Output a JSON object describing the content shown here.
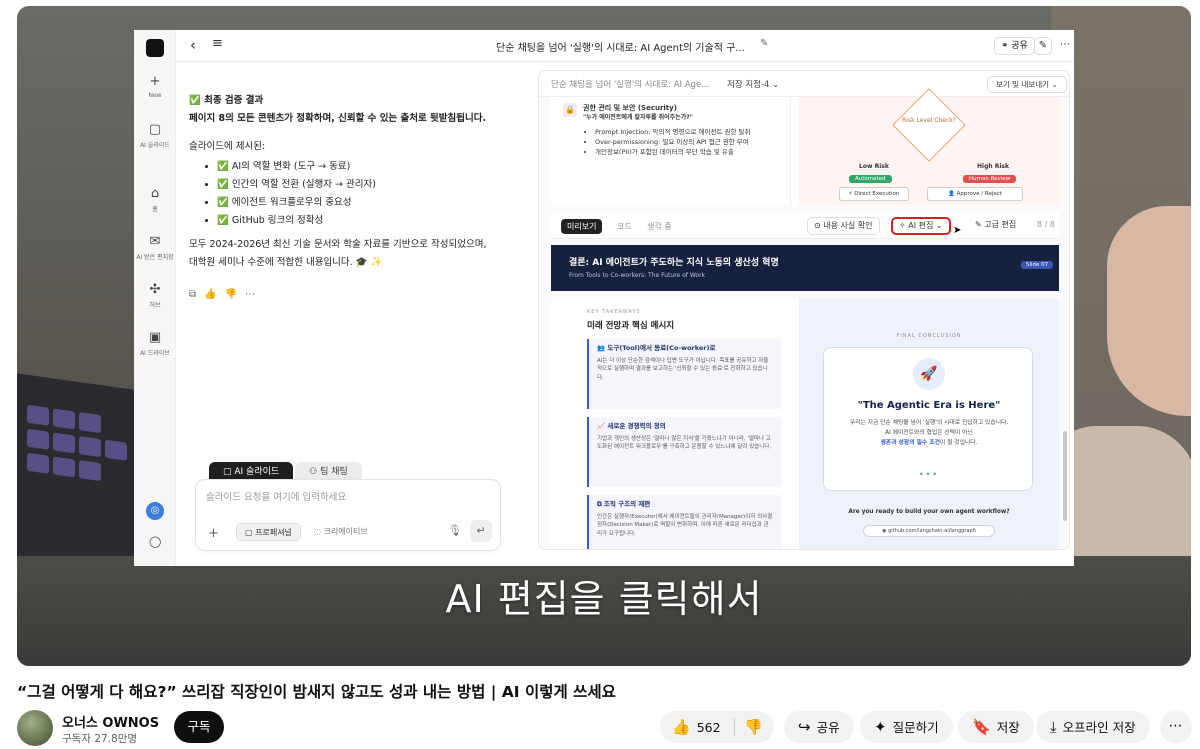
{
  "app": {
    "title": "단순 채팅을 넘어 '실행'의 시대로: AI Agent의 기술적 구...",
    "share": "공유"
  },
  "rail": {
    "items": [
      {
        "label": "New",
        "icon": "plus-icon"
      },
      {
        "label": "AI 슬라이드",
        "icon": "slides-icon"
      },
      {
        "label": "홈",
        "icon": "home-icon"
      },
      {
        "label": "AI 받은 편지함",
        "icon": "inbox-icon"
      },
      {
        "label": "허브",
        "icon": "hub-icon"
      },
      {
        "label": "AI 드라이브",
        "icon": "drive-icon"
      }
    ]
  },
  "chat": {
    "heading": "✅ 최종 검증 결과",
    "summary": "페이지 8의 모든 콘텐츠가 정확하며, 신뢰할 수 있는 출처로 뒷받침됩니다.",
    "intro": "슬라이드에 제시된:",
    "bullets": [
      "✅ AI의 역할 변화 (도구 → 동료)",
      "✅ 인간의 역할 전환 (실행자 → 관리자)",
      "✅ 에이전트 워크플로우의 중요성",
      "✅ GitHub 링크의 정확성"
    ],
    "closing_1": "모두 2024-2026년 최신 기술 문서와 학술 자료를 기반으로 작성되었으며,",
    "closing_2": "대학원 세미나 수준에 적합한 내용입니다. 🎓 ✨"
  },
  "composer": {
    "tab_active": "AI 슬라이드",
    "tab_inactive": "팀 채팅",
    "placeholder": "슬라이드 요청을 여기에 입력하세요",
    "mode_selected": "프로페셔널",
    "mode_other": "크리에이티브"
  },
  "slides": {
    "doc_title": "단순 채팅을 넘어 '실행'의 시대로: AI Age...",
    "version": "저장 지점-4",
    "export": "보기 및 내보내기",
    "top_slide": {
      "section": "권한 관리 및 보안 (Security)",
      "question": "\"누가 에이전트에게 칼자루를 쥐어주는가?\"",
      "items": [
        "Prompt Injection: 악의적 명령으로 에이전트 권한 탈취",
        "Over-permissioning: 필요 이상의 API 접근 권한 부여",
        "개인정보(PII)가 포함된 데이터의 무단 학습 및 유출"
      ],
      "diamond": "Risk Level Check?",
      "low": "Low Risk",
      "high": "High Risk",
      "low_pill": "Automated",
      "high_pill": "Human Review",
      "action_a": "Direct Execution",
      "action_b": "Approve / Reject"
    },
    "toolbar": {
      "preview": "미리보기",
      "code": "코드",
      "thinking": "생각 중",
      "fact_check": "내용 사실 확인",
      "ai_edit": "AI 편집",
      "advanced_edit": "고급 편집",
      "pages": "8 / 8"
    },
    "slide8": {
      "title": "결론: AI 에이전트가 주도하는 지식 노동의 생산성 혁명",
      "subtitle": "From Tools to Co-workers: The Future of Work",
      "badge": "Slide 07",
      "kicker": "KEY TAKEAWAYS",
      "left_title": "미래 전망과 핵심 메시지",
      "cards": [
        {
          "title": "도구(Tool)에서 동료(Co-worker)로",
          "body": "AI는 더 이상 단순한 검색이나 답변 도구가 아닙니다. 목표를 공유하고 자율적으로 실행하며 결과를 보고하는 '신뢰할 수 있는 동료'로 진화하고 있습니다."
        },
        {
          "title": "새로운 경쟁력의 정의",
          "body": "기업과 개인의 생산성은 '얼마나 많은 지식'을 가졌느냐가 아니라, '얼마나 고도화된 에이전트 워크플로우'를 구축하고 운용할 수 있느냐에 달려 있습니다."
        },
        {
          "title": "조직 구조의 재편",
          "body": "인간은 실행자(Executor)에서 에이전트들의 관리자(Manager)이자 의사결정자(Decision Maker)로 역할이 변화하며, 이에 따른 새로운 리더십과 관리가 요구됩니다."
        }
      ],
      "final_label": "FINAL CONCLUSION",
      "final_heading": "\"The Agentic Era is Here\"",
      "final_body_1": "우리는 지금 단순 채팅을 넘어 '실행'의 시대로 진입하고 있습니다.",
      "final_body_2": "AI 에이전트와의 협업은 선택이 아닌",
      "final_highlight": "생존과 성장의 필수 조건",
      "final_body_3": "이 될 것입니다.",
      "cta": "Are you ready to build your own agent workflow?",
      "github": "github.com/langchain-ai/langgraph"
    }
  },
  "video": {
    "caption": "AI 편집을 클릭해서"
  },
  "youtube": {
    "title": "“그걸 어떻게 다 해요?” 쓰리잡 직장인이 밤새지 않고도 성과 내는 방법 | AI 이렇게 쓰세요",
    "channel": "오너스 OWNOS",
    "subscribers": "구독자 27.8만명",
    "subscribe": "구독",
    "likes": "562",
    "share": "공유",
    "ask": "질문하기",
    "save": "저장",
    "offline": "오프라인 저장"
  }
}
